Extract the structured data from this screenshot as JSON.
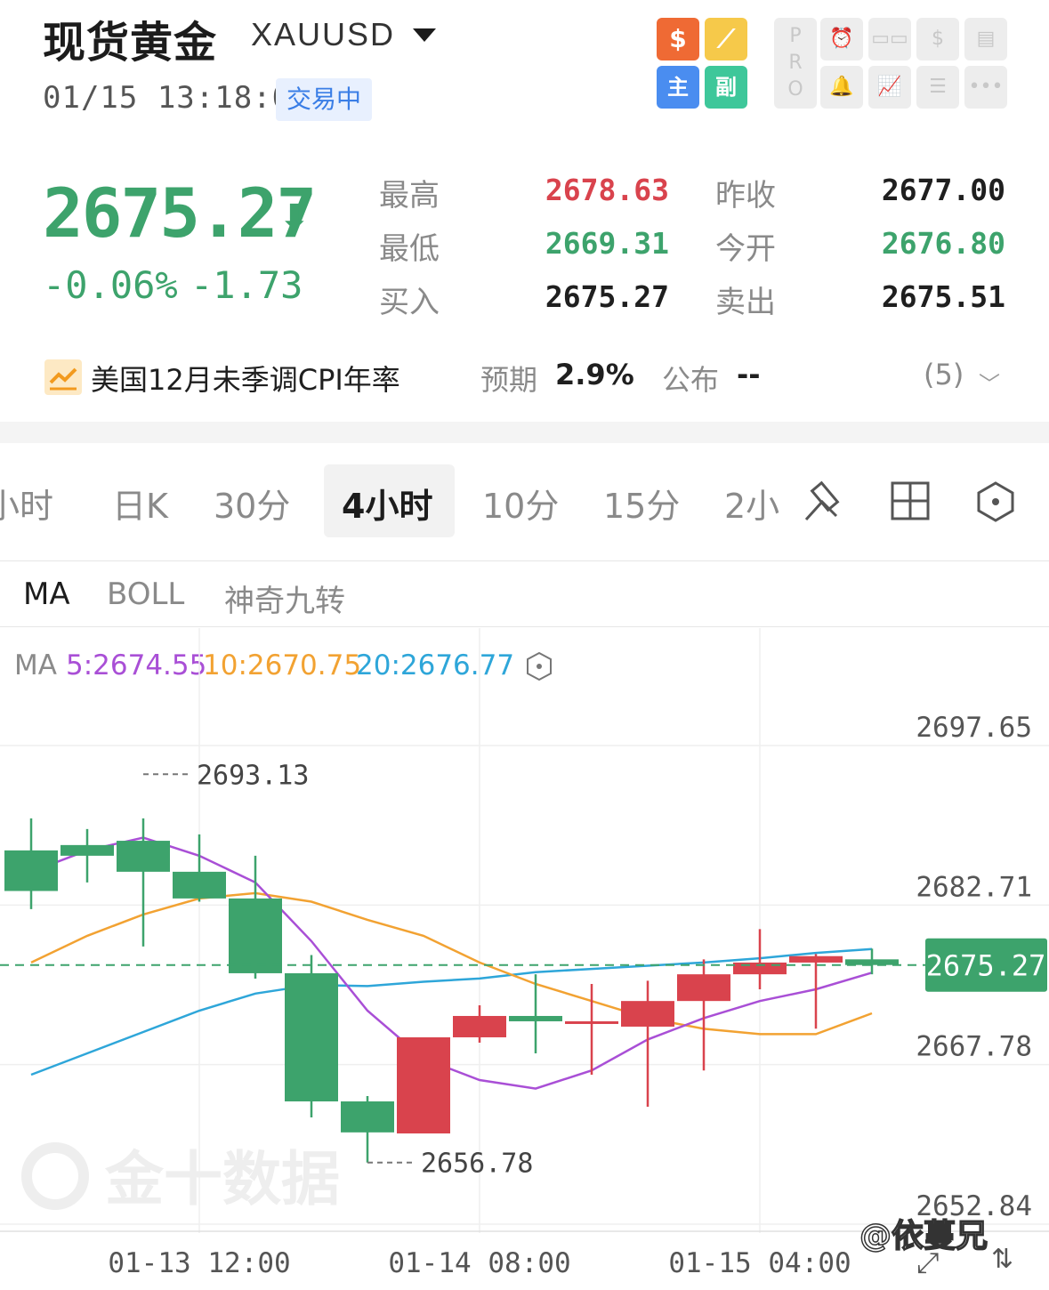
{
  "header": {
    "title": "现货黄金",
    "symbol": "XAUUSD",
    "timestamp": "01/15 13:18:06",
    "status": "交易中",
    "tool_icons": {
      "dollar": "$",
      "brush": "⟋",
      "main": "主",
      "sub": "副"
    },
    "gray_icons": [
      "PRO",
      "alarm-icon",
      "toggle-icon",
      "coin-icon",
      "report-icon",
      "bell-icon",
      "trend-icon",
      "list-icon",
      "more-icon"
    ]
  },
  "quote": {
    "price": "2675.27",
    "change_pct": "-0.06%",
    "change": "-1.73",
    "stats": [
      {
        "label": "最高",
        "value": "2678.63",
        "color": "red"
      },
      {
        "label": "昨收",
        "value": "2677.00",
        "color": "dark"
      },
      {
        "label": "最低",
        "value": "2669.31",
        "color": "green"
      },
      {
        "label": "今开",
        "value": "2676.80",
        "color": "green"
      },
      {
        "label": "买入",
        "value": "2675.27",
        "color": "dark"
      },
      {
        "label": "卖出",
        "value": "2675.51",
        "color": "dark"
      }
    ]
  },
  "event": {
    "name": "美国12月未季调CPI年率",
    "expected_label": "预期",
    "expected": "2.9%",
    "published_label": "公布",
    "published": "--",
    "count": "(5)"
  },
  "periods": [
    "小时",
    "日K",
    "30分",
    "4小时",
    "10分",
    "15分",
    "2小"
  ],
  "active_period": "4小时",
  "indicators": [
    "MA",
    "BOLL",
    "神奇九转"
  ],
  "active_indicator": "MA",
  "ma_legend": {
    "prefix": "MA",
    "ma5": "5:2674.55",
    "ma10": "10:2670.75",
    "ma20": "20:2676.77"
  },
  "colors": {
    "up": "#d9434d",
    "down": "#3da36c",
    "ma5": "#a94fd6",
    "ma10": "#f2a232",
    "ma20": "#2ea6d9"
  },
  "watermark": "金十数据",
  "credit": "@依蔓兄",
  "chart_data": {
    "type": "candlestick",
    "y_ticks": [
      "2697.65",
      "2682.71",
      "2667.78",
      "2652.84"
    ],
    "ylim": [
      2652.84,
      2697.65
    ],
    "x_ticks": [
      "01-13 12:00",
      "01-14 08:00",
      "01-15 04:00"
    ],
    "last_price": "2675.27",
    "high_marker": "2693.13",
    "low_marker": "2656.78",
    "candles": [
      {
        "o": 2686.0,
        "h": 2689.0,
        "l": 2680.5,
        "c": 2682.2
      },
      {
        "o": 2686.5,
        "h": 2688.0,
        "l": 2683.0,
        "c": 2685.5
      },
      {
        "o": 2686.9,
        "h": 2689.0,
        "l": 2677.0,
        "c": 2684.0
      },
      {
        "o": 2684.0,
        "h": 2687.5,
        "l": 2681.2,
        "c": 2681.5
      },
      {
        "o": 2681.5,
        "h": 2685.5,
        "l": 2674.0,
        "c": 2674.5
      },
      {
        "o": 2674.5,
        "h": 2676.2,
        "l": 2661.0,
        "c": 2662.5
      },
      {
        "o": 2662.5,
        "h": 2663.0,
        "l": 2656.78,
        "c": 2659.6
      },
      {
        "o": 2659.5,
        "h": 2667.0,
        "l": 2659.5,
        "c": 2668.5
      },
      {
        "o": 2668.5,
        "h": 2671.5,
        "l": 2668.0,
        "c": 2670.5
      },
      {
        "o": 2670.5,
        "h": 2674.4,
        "l": 2667.0,
        "c": 2670.0
      },
      {
        "o": 2670.0,
        "h": 2673.5,
        "l": 2665.0,
        "c": 2670.0
      },
      {
        "o": 2669.5,
        "h": 2673.8,
        "l": 2662.0,
        "c": 2671.9
      },
      {
        "o": 2671.9,
        "h": 2675.8,
        "l": 2665.4,
        "c": 2674.4
      },
      {
        "o": 2674.4,
        "h": 2678.63,
        "l": 2673.0,
        "c": 2675.5
      },
      {
        "o": 2675.5,
        "h": 2676.3,
        "l": 2669.31,
        "c": 2676.1
      },
      {
        "o": 2675.8,
        "h": 2676.8,
        "l": 2674.4,
        "c": 2675.27
      }
    ],
    "ma5": [
      2684.0,
      2686.0,
      2687.2,
      2685.5,
      2683.0,
      2677.5,
      2671.0,
      2666.5,
      2664.5,
      2663.7,
      2665.4,
      2668.3,
      2670.3,
      2671.9,
      2673.0,
      2674.55
    ],
    "ma10": [
      2675.5,
      2678.0,
      2680.0,
      2681.5,
      2682.0,
      2681.2,
      2679.5,
      2678.0,
      2675.5,
      2673.5,
      2671.9,
      2670.3,
      2669.3,
      2668.8,
      2668.8,
      2670.75
    ],
    "ma20": [
      2665.0,
      2667.0,
      2669.0,
      2671.0,
      2672.6,
      2673.4,
      2673.3,
      2673.7,
      2674.0,
      2674.6,
      2674.9,
      2675.2,
      2675.5,
      2675.9,
      2676.4,
      2676.77
    ]
  }
}
